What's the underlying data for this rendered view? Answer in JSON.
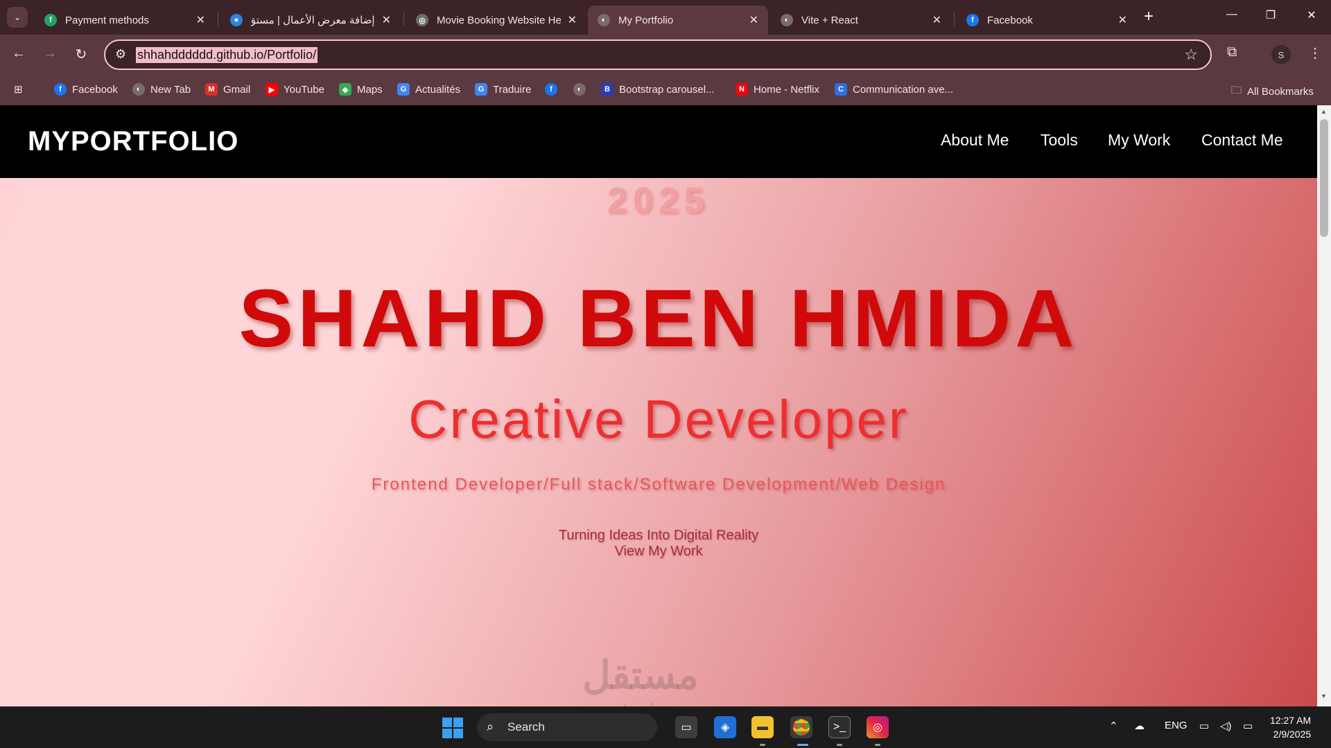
{
  "browser": {
    "tabs": [
      {
        "title": "Payment methods",
        "favicon_color": "#1fa463",
        "favicon_glyph": "f",
        "icon": "fiverr-icon"
      },
      {
        "title": "إضافة معرض الأعمال | مستق",
        "favicon_color": "#2d86e0",
        "favicon_glyph": "●",
        "icon": "mostaql-icon"
      },
      {
        "title": "Movie Booking Website He",
        "favicon_color": "#6b6b6b",
        "favicon_glyph": "◎",
        "icon": "openai-icon"
      },
      {
        "title": "My Portfolio",
        "favicon_color": "#7a6a6e",
        "favicon_glyph": "◐",
        "icon": "globe-icon",
        "active": true
      },
      {
        "title": "Vite + React",
        "favicon_color": "#7a6a6e",
        "favicon_glyph": "◐",
        "icon": "globe-icon"
      },
      {
        "title": "Facebook",
        "favicon_color": "#1877f2",
        "favicon_glyph": "f",
        "icon": "facebook-icon"
      }
    ],
    "address_bar": {
      "url": "shhahdddddd.github.io/Portfolio/"
    },
    "profile_initial": "S",
    "bookmarks": [
      {
        "label": "Facebook",
        "icon": "facebook-icon",
        "color": "#1877f2",
        "glyph": "f"
      },
      {
        "label": "New Tab",
        "icon": "globe-icon",
        "color": "#7a6a6e",
        "glyph": "◐"
      },
      {
        "label": "Gmail",
        "icon": "gmail-icon",
        "color": "#d93025",
        "glyph": "M"
      },
      {
        "label": "YouTube",
        "icon": "youtube-icon",
        "color": "#ff0000",
        "glyph": "▶"
      },
      {
        "label": "Maps",
        "icon": "maps-icon",
        "color": "#34a853",
        "glyph": "◆"
      },
      {
        "label": "Actualités",
        "icon": "news-icon",
        "color": "#4285f4",
        "glyph": "G"
      },
      {
        "label": "Traduire",
        "icon": "translate-icon",
        "color": "#4285f4",
        "glyph": "G"
      },
      {
        "label": "",
        "icon": "facebook-icon",
        "color": "#1877f2",
        "glyph": "f"
      },
      {
        "label": "",
        "icon": "globe-icon",
        "color": "#7a6a6e",
        "glyph": "◐"
      },
      {
        "label": "Bootstrap carousel...",
        "icon": "bootstrap-icon",
        "color": "#2a3cb8",
        "glyph": "B"
      },
      {
        "label": "Home - Netflix",
        "icon": "netflix-icon",
        "color": "#e50914",
        "glyph": "N"
      },
      {
        "label": "Communication ave...",
        "icon": "chat-icon",
        "color": "#2f6fe0",
        "glyph": "C"
      }
    ],
    "all_bookmarks_label": "All Bookmarks"
  },
  "site": {
    "brand": "MYPORTFOLIO",
    "nav": [
      "About Me",
      "Tools",
      "My Work",
      "Contact Me"
    ],
    "hero": {
      "year": "2025",
      "name": "SHAHD BEN HMIDA",
      "role": "Creative Developer",
      "tags": "Frontend Developer/Full stack/Software Development/Web Design",
      "tagline": "Turning Ideas Into Digital Reality",
      "cta": "View My Work"
    },
    "watermark": "مستقل",
    "watermark_sub": "mostaql.com"
  },
  "taskbar": {
    "search_label": "Search",
    "language": "ENG",
    "time": "12:27 AM",
    "date": "2/9/2025"
  }
}
